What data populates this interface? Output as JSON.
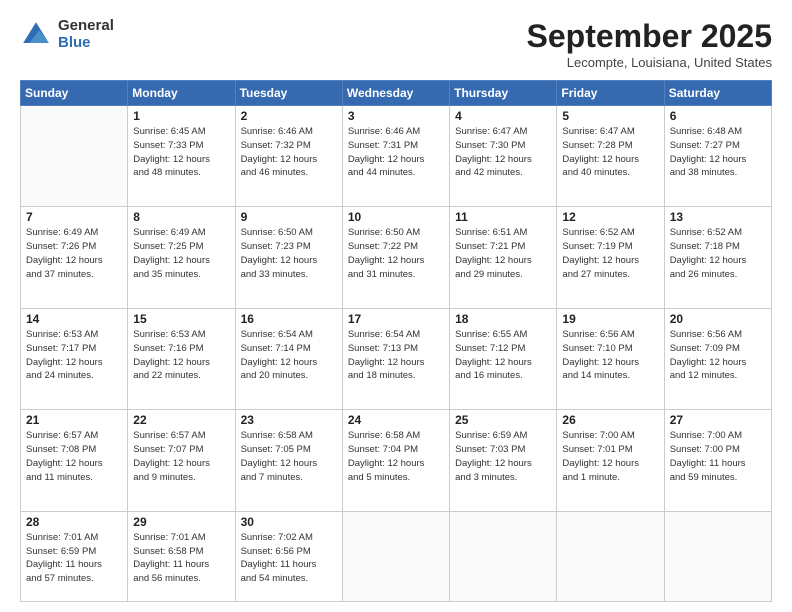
{
  "header": {
    "logo_general": "General",
    "logo_blue": "Blue",
    "title": "September 2025",
    "location": "Lecompte, Louisiana, United States"
  },
  "weekdays": [
    "Sunday",
    "Monday",
    "Tuesday",
    "Wednesday",
    "Thursday",
    "Friday",
    "Saturday"
  ],
  "weeks": [
    [
      {
        "day": "",
        "info": ""
      },
      {
        "day": "1",
        "info": "Sunrise: 6:45 AM\nSunset: 7:33 PM\nDaylight: 12 hours\nand 48 minutes."
      },
      {
        "day": "2",
        "info": "Sunrise: 6:46 AM\nSunset: 7:32 PM\nDaylight: 12 hours\nand 46 minutes."
      },
      {
        "day": "3",
        "info": "Sunrise: 6:46 AM\nSunset: 7:31 PM\nDaylight: 12 hours\nand 44 minutes."
      },
      {
        "day": "4",
        "info": "Sunrise: 6:47 AM\nSunset: 7:30 PM\nDaylight: 12 hours\nand 42 minutes."
      },
      {
        "day": "5",
        "info": "Sunrise: 6:47 AM\nSunset: 7:28 PM\nDaylight: 12 hours\nand 40 minutes."
      },
      {
        "day": "6",
        "info": "Sunrise: 6:48 AM\nSunset: 7:27 PM\nDaylight: 12 hours\nand 38 minutes."
      }
    ],
    [
      {
        "day": "7",
        "info": "Sunrise: 6:49 AM\nSunset: 7:26 PM\nDaylight: 12 hours\nand 37 minutes."
      },
      {
        "day": "8",
        "info": "Sunrise: 6:49 AM\nSunset: 7:25 PM\nDaylight: 12 hours\nand 35 minutes."
      },
      {
        "day": "9",
        "info": "Sunrise: 6:50 AM\nSunset: 7:23 PM\nDaylight: 12 hours\nand 33 minutes."
      },
      {
        "day": "10",
        "info": "Sunrise: 6:50 AM\nSunset: 7:22 PM\nDaylight: 12 hours\nand 31 minutes."
      },
      {
        "day": "11",
        "info": "Sunrise: 6:51 AM\nSunset: 7:21 PM\nDaylight: 12 hours\nand 29 minutes."
      },
      {
        "day": "12",
        "info": "Sunrise: 6:52 AM\nSunset: 7:19 PM\nDaylight: 12 hours\nand 27 minutes."
      },
      {
        "day": "13",
        "info": "Sunrise: 6:52 AM\nSunset: 7:18 PM\nDaylight: 12 hours\nand 26 minutes."
      }
    ],
    [
      {
        "day": "14",
        "info": "Sunrise: 6:53 AM\nSunset: 7:17 PM\nDaylight: 12 hours\nand 24 minutes."
      },
      {
        "day": "15",
        "info": "Sunrise: 6:53 AM\nSunset: 7:16 PM\nDaylight: 12 hours\nand 22 minutes."
      },
      {
        "day": "16",
        "info": "Sunrise: 6:54 AM\nSunset: 7:14 PM\nDaylight: 12 hours\nand 20 minutes."
      },
      {
        "day": "17",
        "info": "Sunrise: 6:54 AM\nSunset: 7:13 PM\nDaylight: 12 hours\nand 18 minutes."
      },
      {
        "day": "18",
        "info": "Sunrise: 6:55 AM\nSunset: 7:12 PM\nDaylight: 12 hours\nand 16 minutes."
      },
      {
        "day": "19",
        "info": "Sunrise: 6:56 AM\nSunset: 7:10 PM\nDaylight: 12 hours\nand 14 minutes."
      },
      {
        "day": "20",
        "info": "Sunrise: 6:56 AM\nSunset: 7:09 PM\nDaylight: 12 hours\nand 12 minutes."
      }
    ],
    [
      {
        "day": "21",
        "info": "Sunrise: 6:57 AM\nSunset: 7:08 PM\nDaylight: 12 hours\nand 11 minutes."
      },
      {
        "day": "22",
        "info": "Sunrise: 6:57 AM\nSunset: 7:07 PM\nDaylight: 12 hours\nand 9 minutes."
      },
      {
        "day": "23",
        "info": "Sunrise: 6:58 AM\nSunset: 7:05 PM\nDaylight: 12 hours\nand 7 minutes."
      },
      {
        "day": "24",
        "info": "Sunrise: 6:58 AM\nSunset: 7:04 PM\nDaylight: 12 hours\nand 5 minutes."
      },
      {
        "day": "25",
        "info": "Sunrise: 6:59 AM\nSunset: 7:03 PM\nDaylight: 12 hours\nand 3 minutes."
      },
      {
        "day": "26",
        "info": "Sunrise: 7:00 AM\nSunset: 7:01 PM\nDaylight: 12 hours\nand 1 minute."
      },
      {
        "day": "27",
        "info": "Sunrise: 7:00 AM\nSunset: 7:00 PM\nDaylight: 11 hours\nand 59 minutes."
      }
    ],
    [
      {
        "day": "28",
        "info": "Sunrise: 7:01 AM\nSunset: 6:59 PM\nDaylight: 11 hours\nand 57 minutes."
      },
      {
        "day": "29",
        "info": "Sunrise: 7:01 AM\nSunset: 6:58 PM\nDaylight: 11 hours\nand 56 minutes."
      },
      {
        "day": "30",
        "info": "Sunrise: 7:02 AM\nSunset: 6:56 PM\nDaylight: 11 hours\nand 54 minutes."
      },
      {
        "day": "",
        "info": ""
      },
      {
        "day": "",
        "info": ""
      },
      {
        "day": "",
        "info": ""
      },
      {
        "day": "",
        "info": ""
      }
    ]
  ]
}
